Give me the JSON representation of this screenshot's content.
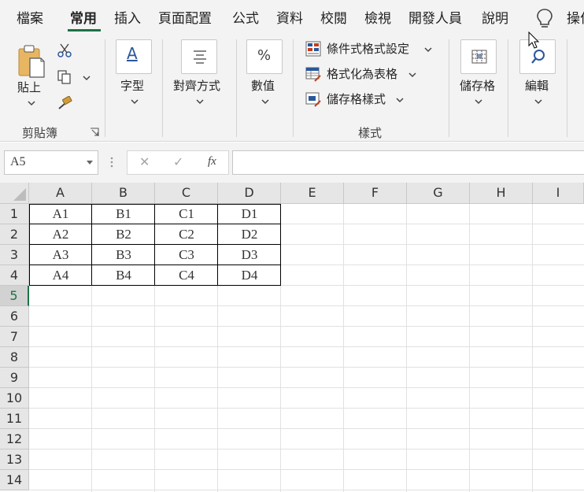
{
  "tabs": [
    "檔案",
    "常用",
    "插入",
    "頁面配置",
    "公式",
    "資料",
    "校閱",
    "檢視",
    "開發人員",
    "說明",
    "操作"
  ],
  "active_tab": "常用",
  "ribbon": {
    "paste_label": "貼上",
    "clipboard_group": "剪貼簿",
    "font_label": "字型",
    "alignment_label": "對齊方式",
    "number_label": "數值",
    "conditional_formatting": "條件式格式設定",
    "format_as_table": "格式化為表格",
    "cell_styles": "儲存格樣式",
    "styles_group": "樣式",
    "cells_label": "儲存格",
    "editing_label": "編輯",
    "font_icon_glyph": "A",
    "number_icon_glyph": "%"
  },
  "formula_bar": {
    "name_box": "A5",
    "fx": "fx",
    "cancel_glyph": "✕",
    "enter_glyph": "✓",
    "formula": ""
  },
  "grid": {
    "columns": [
      "A",
      "B",
      "C",
      "D",
      "E",
      "F",
      "G",
      "H",
      "I"
    ],
    "rows": [
      "1",
      "2",
      "3",
      "4",
      "5",
      "6",
      "7",
      "8",
      "9",
      "10",
      "11",
      "12",
      "13",
      "14"
    ],
    "selected_row": "5",
    "cells": [
      [
        "A1",
        "B1",
        "C1",
        "D1"
      ],
      [
        "A2",
        "B2",
        "C2",
        "D2"
      ],
      [
        "A3",
        "B3",
        "C3",
        "D3"
      ],
      [
        "A4",
        "B4",
        "C4",
        "D4"
      ]
    ]
  },
  "colors": {
    "accent": "#1e7145",
    "ribbon_bg": "#f3f3f3",
    "header_bg": "#e6e6e6"
  }
}
